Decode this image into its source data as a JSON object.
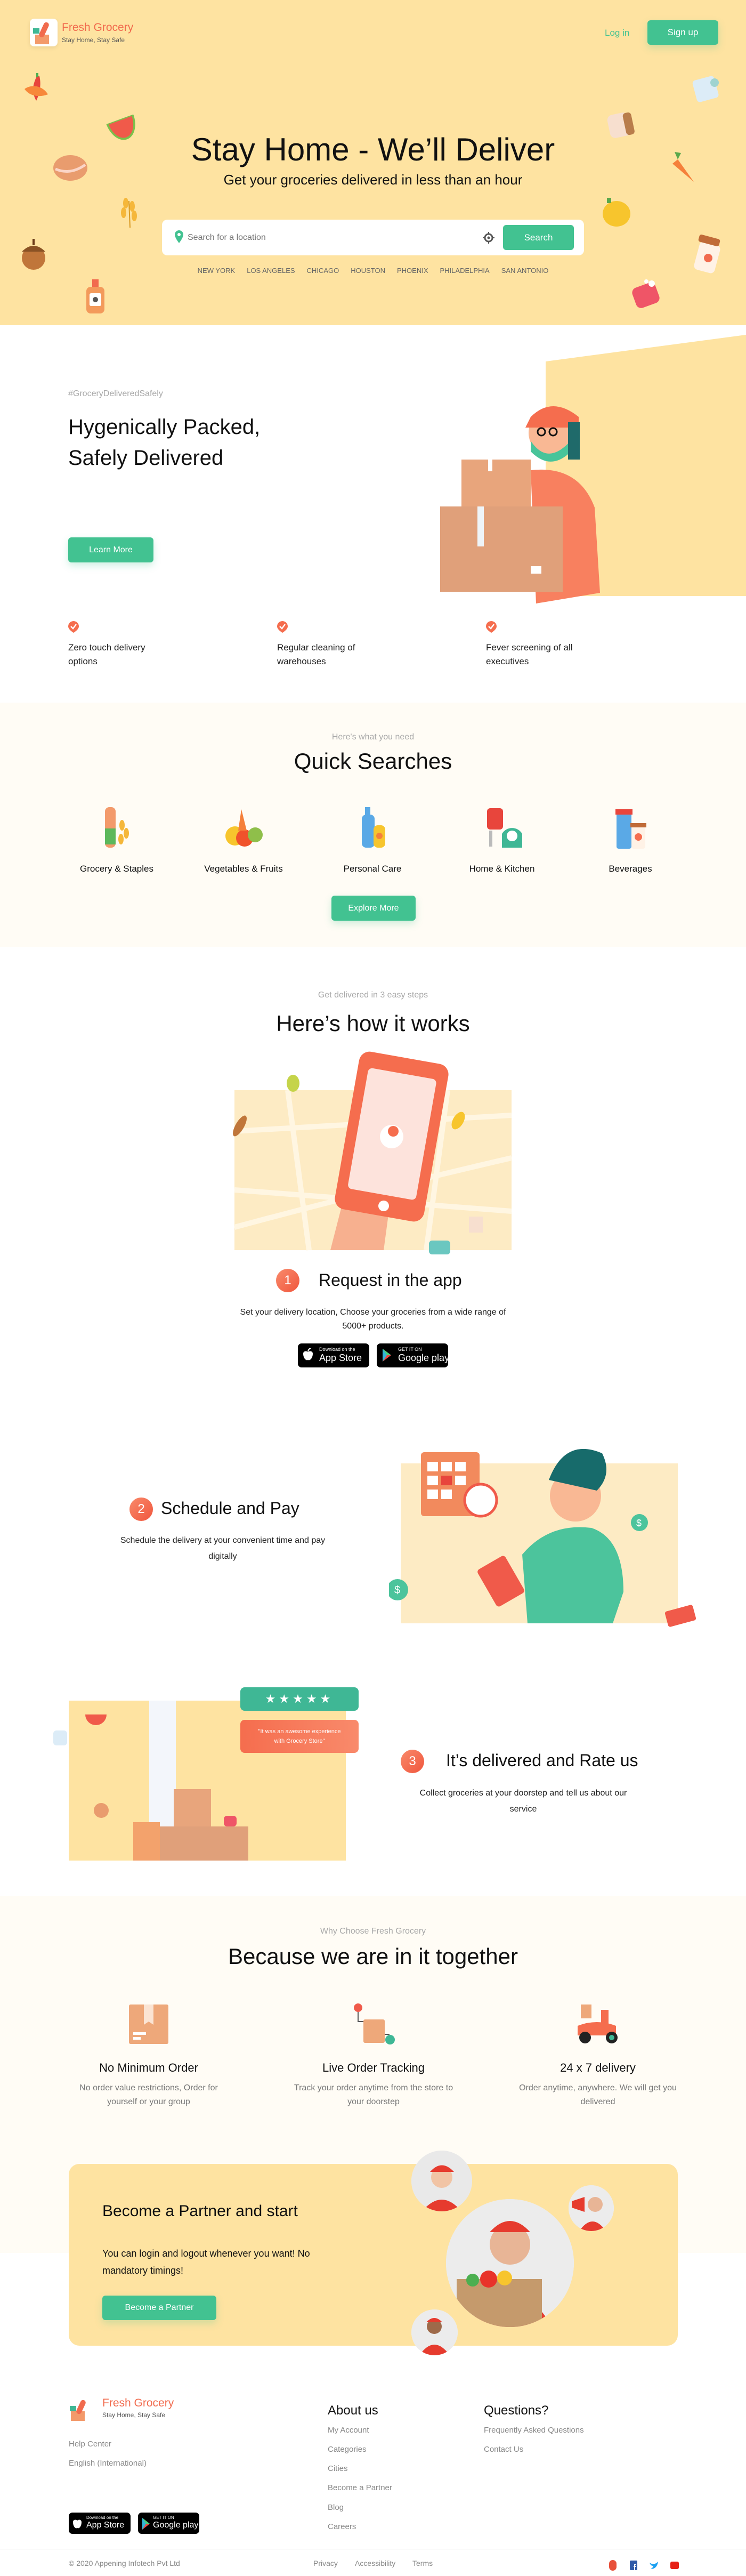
{
  "colors": {
    "accent_green": "#42c291",
    "accent_orange": "#f16b4e",
    "hero_bg": "#fee3a1",
    "section_bg": "#fffcf5"
  },
  "header": {
    "brand_name": "Fresh Grocery",
    "tagline": "Stay Home, Stay Safe",
    "login": "Log in",
    "signup": "Sign up"
  },
  "hero": {
    "title": "Stay Home - We’ll Deliver",
    "subtitle": "Get your groceries delivered in less than an hour",
    "search_placeholder": "Search for a location",
    "search_button": "Search",
    "cities": [
      "NEW YORK",
      "LOS ANGELES",
      "CHICAGO",
      "HOUSTON",
      "PHOENIX",
      "PHILADELPHIA",
      "SAN ANTONIO"
    ]
  },
  "safety": {
    "hashtag": "#GroceryDeliveredSafely",
    "title_line1": "Hygenically Packed,",
    "title_line2": "Safely Delivered",
    "learn_more": "Learn More",
    "features": [
      "Zero touch delivery options",
      "Regular cleaning of warehouses",
      "Fever screening of all executives"
    ]
  },
  "quick": {
    "eyebrow": "Here's what you need",
    "title": "Quick Searches",
    "categories": [
      "Grocery & Staples",
      "Vegetables & Fruits",
      "Personal Care",
      "Home & Kitchen",
      "Beverages"
    ],
    "explore": "Explore More"
  },
  "how": {
    "eyebrow": "Get delivered in 3 easy steps",
    "title": "Here’s how it works",
    "steps": [
      {
        "number": "1",
        "title": "Request in the app",
        "desc": "Set your delivery location, Choose your groceries from a wide range of 5000+ products."
      },
      {
        "number": "2",
        "title": "Schedule and Pay",
        "desc": "Schedule the delivery at your convenient time and pay digitally"
      },
      {
        "number": "3",
        "title": "It’s delivered and Rate us",
        "desc": "Collect groceries at your doorstep and tell us about our service"
      }
    ],
    "app_store": {
      "small": "Download on the",
      "big": "App Store"
    },
    "google_play": {
      "small": "GET IT ON",
      "big": "Google play"
    },
    "review": {
      "rating": 5,
      "quote": "\"It was an awesome experience with Grocery Store\""
    }
  },
  "why": {
    "eyebrow": "Why Choose Fresh Grocery",
    "title": "Because we are in it together",
    "features": [
      {
        "title": "No Minimum Order",
        "desc": "No order value restrictions, Order for yourself or your group",
        "icon": "box-icon"
      },
      {
        "title": "Live Order Tracking",
        "desc": "Track your order anytime from the store to your doorstep",
        "icon": "tracking-icon"
      },
      {
        "title": "24 x 7 delivery",
        "desc": "Order anytime, anywhere. We will get you delivered",
        "icon": "scooter-icon"
      }
    ]
  },
  "partner": {
    "title": "Become a Partner and start",
    "desc": "You can login and logout whenever you want! No mandatory timings!",
    "button": "Become a Partner"
  },
  "footer": {
    "brand_name": "Fresh Grocery",
    "tagline": "Stay Home, Stay Safe",
    "help": "Help Center",
    "language": "English (International)",
    "about_title": "About us",
    "about_links": [
      "My Account",
      "Categories",
      "Cities",
      "Become a Partner",
      "Blog",
      "Careers"
    ],
    "questions_title": "Questions?",
    "questions_links": [
      "Frequently Asked Questions",
      "Contact Us"
    ],
    "copyright": "© 2020 Appening Infotech Pvt Ltd",
    "legal_links": [
      "Privacy",
      "Accessibility",
      "Terms"
    ],
    "social": [
      "instagram-icon",
      "facebook-icon",
      "twitter-icon",
      "youtube-icon"
    ]
  }
}
